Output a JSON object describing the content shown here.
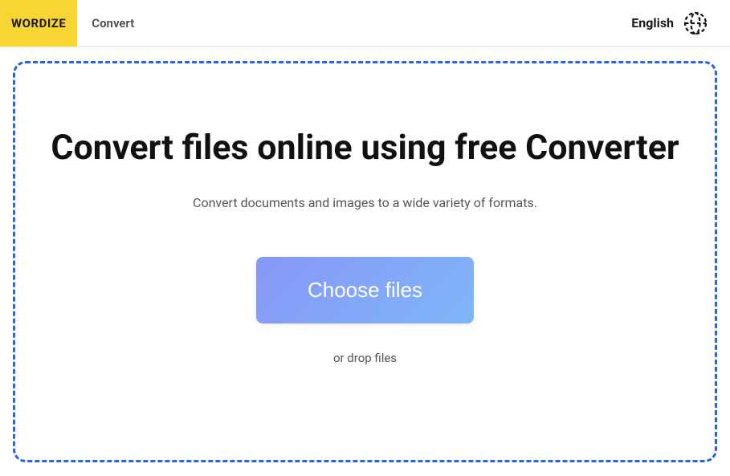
{
  "header": {
    "logo": "WORDIZE",
    "nav": {
      "convert": "Convert"
    },
    "language": {
      "label": "English"
    }
  },
  "main": {
    "headline": "Convert files online using free Converter",
    "subtitle": "Convert documents and images to a wide variety of formats.",
    "choose_button": "Choose files",
    "drop_hint": "or drop files"
  }
}
